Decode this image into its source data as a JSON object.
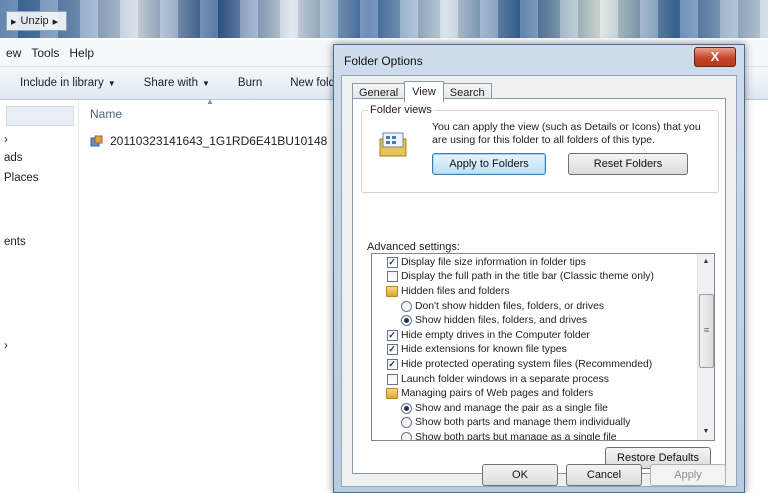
{
  "explorer": {
    "breadcrumb": "Unzip",
    "menu": [
      "ew",
      "Tools",
      "Help"
    ],
    "toolbar": {
      "include_label": "Include in library",
      "share_label": "Share with",
      "burn_label": "Burn",
      "new_folder_label": "New fold"
    },
    "nav_items": [
      "ads",
      "Places",
      "ents"
    ],
    "column_header": "Name",
    "file_name": "20110323141643_1G1RD6E41BU10148"
  },
  "dialog": {
    "title": "Folder Options",
    "close_glyph": "X",
    "tabs": [
      "General",
      "View",
      "Search"
    ],
    "active_tab": "View",
    "folder_views": {
      "legend": "Folder views",
      "description": "You can apply the view (such as Details or Icons) that you are using for this folder to all folders of this type.",
      "apply_label": "Apply to Folders",
      "reset_label": "Reset Folders"
    },
    "advanced_label": "Advanced settings:",
    "settings": [
      {
        "type": "checkbox",
        "checked": true,
        "indent": 1,
        "label": "Display file size information in folder tips"
      },
      {
        "type": "checkbox",
        "checked": false,
        "indent": 1,
        "label": "Display the full path in the title bar (Classic theme only)"
      },
      {
        "type": "folder",
        "indent": 1,
        "label": "Hidden files and folders"
      },
      {
        "type": "radio",
        "checked": false,
        "indent": 2,
        "label": "Don't show hidden files, folders, or drives"
      },
      {
        "type": "radio",
        "checked": true,
        "indent": 2,
        "label": "Show hidden files, folders, and drives"
      },
      {
        "type": "checkbox",
        "checked": true,
        "indent": 1,
        "label": "Hide empty drives in the Computer folder"
      },
      {
        "type": "checkbox",
        "checked": true,
        "indent": 1,
        "label": "Hide extensions for known file types"
      },
      {
        "type": "checkbox",
        "checked": true,
        "indent": 1,
        "label": "Hide protected operating system files (Recommended)"
      },
      {
        "type": "checkbox",
        "checked": false,
        "indent": 1,
        "label": "Launch folder windows in a separate process"
      },
      {
        "type": "folder",
        "indent": 1,
        "label": "Managing pairs of Web pages and folders"
      },
      {
        "type": "radio",
        "checked": true,
        "indent": 2,
        "label": "Show and manage the pair as a single file"
      },
      {
        "type": "radio",
        "checked": false,
        "indent": 2,
        "label": "Show both parts and manage them individually"
      },
      {
        "type": "radio",
        "checked": false,
        "indent": 2,
        "label": "Show both parts but manage as a single file"
      }
    ],
    "restore_label": "Restore Defaults",
    "ok_label": "OK",
    "cancel_label": "Cancel",
    "apply_label": "Apply"
  }
}
